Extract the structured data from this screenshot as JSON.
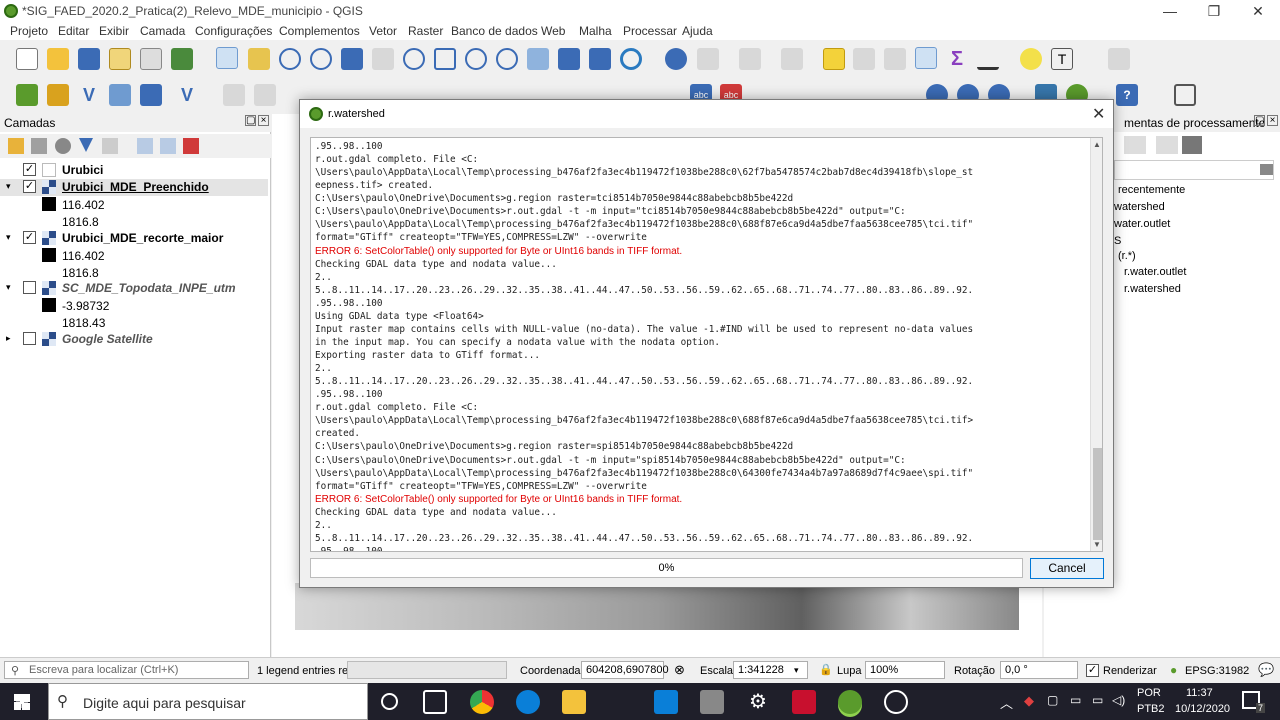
{
  "window": {
    "title": "*SIG_FAED_2020.2_Pratica(2)_Relevo_MDE_municipio - QGIS"
  },
  "menus": [
    "Projeto",
    "Editar",
    "Exibir",
    "Camada",
    "Configurações",
    "Complementos",
    "Vetor",
    "Raster",
    "Banco de dados",
    "Web",
    "Malha",
    "Processar",
    "Ajuda"
  ],
  "layers_panel": {
    "title": "Camadas",
    "layers": [
      {
        "name": "Urubici",
        "checked": true,
        "bold": true,
        "italic": false
      },
      {
        "name": "Urubici_MDE_Preenchido",
        "checked": true,
        "bold": true,
        "underline": true,
        "min": "116.402",
        "max": "1816.8"
      },
      {
        "name": "Urubici_MDE_recorte_maior",
        "checked": true,
        "bold": true,
        "min": "116.402",
        "max": "1816.8"
      },
      {
        "name": "SC_MDE_Topodata_INPE_utm",
        "checked": false,
        "italic": true,
        "min": "-3.98732",
        "max": "1818.43"
      },
      {
        "name": "Google Satellite",
        "checked": false,
        "italic": true
      }
    ]
  },
  "processing_panel": {
    "title": "mentas de processamento",
    "items": [
      "recentemente",
      "watershed",
      "water.outlet",
      "S",
      "(r.*)",
      "r.water.outlet",
      "r.watershed"
    ]
  },
  "dialog": {
    "title": "r.watershed",
    "log_lines": [
      {
        "t": ".95..98..100",
        "err": false
      },
      {
        "t": "r.out.gdal completo. File <C:",
        "err": false
      },
      {
        "t": "\\Users\\paulo\\AppData\\Local\\Temp\\processing_b476af2fa3ec4b119472f1038be288c0\\62f7ba5478574c2bab7d8ec4d39418fb\\slope_st",
        "err": false
      },
      {
        "t": "eepness.tif> created.",
        "err": false
      },
      {
        "t": "C:\\Users\\paulo\\OneDrive\\Documents>g.region raster=tci8514b7050e9844c88abebcb8b5be422d",
        "err": false
      },
      {
        "t": "C:\\Users\\paulo\\OneDrive\\Documents>r.out.gdal -t -m input=\"tci8514b7050e9844c88abebcb8b5be422d\" output=\"C:",
        "err": false
      },
      {
        "t": "\\Users\\paulo\\AppData\\Local\\Temp\\processing_b476af2fa3ec4b119472f1038be288c0\\688f87e6ca9d4a5dbe7faa5638cee785\\tci.tif\"",
        "err": false
      },
      {
        "t": "format=\"GTiff\" createopt=\"TFW=YES,COMPRESS=LZW\" --overwrite",
        "err": false
      },
      {
        "t": "ERROR 6: SetColorTable() only supported for Byte or UInt16 bands in TIFF format.",
        "err": true
      },
      {
        "t": "Checking GDAL data type and nodata value...",
        "err": false
      },
      {
        "t": "2..",
        "err": false
      },
      {
        "t": "5..8..11..14..17..20..23..26..29..32..35..38..41..44..47..50..53..56..59..62..65..68..71..74..77..80..83..86..89..92.",
        "err": false
      },
      {
        "t": ".95..98..100",
        "err": false
      },
      {
        "t": "Using GDAL data type <Float64>",
        "err": false
      },
      {
        "t": "Input raster map contains cells with NULL-value (no-data). The value -1.#IND will be used to represent no-data values",
        "err": false
      },
      {
        "t": "in the input map. You can specify a nodata value with the nodata option.",
        "err": false
      },
      {
        "t": "Exporting raster data to GTiff format...",
        "err": false
      },
      {
        "t": "2..",
        "err": false
      },
      {
        "t": "5..8..11..14..17..20..23..26..29..32..35..38..41..44..47..50..53..56..59..62..65..68..71..74..77..80..83..86..89..92.",
        "err": false
      },
      {
        "t": ".95..98..100",
        "err": false
      },
      {
        "t": "r.out.gdal completo. File <C:",
        "err": false
      },
      {
        "t": "\\Users\\paulo\\AppData\\Local\\Temp\\processing_b476af2fa3ec4b119472f1038be288c0\\688f87e6ca9d4a5dbe7faa5638cee785\\tci.tif>",
        "err": false
      },
      {
        "t": "created.",
        "err": false
      },
      {
        "t": "C:\\Users\\paulo\\OneDrive\\Documents>g.region raster=spi8514b7050e9844c88abebcb8b5be422d",
        "err": false
      },
      {
        "t": "C:\\Users\\paulo\\OneDrive\\Documents>r.out.gdal -t -m input=\"spi8514b7050e9844c88abebcb8b5be422d\" output=\"C:",
        "err": false
      },
      {
        "t": "\\Users\\paulo\\AppData\\Local\\Temp\\processing_b476af2fa3ec4b119472f1038be288c0\\64300fe7434a4b7a97a8689d7f4c9aee\\spi.tif\"",
        "err": false
      },
      {
        "t": "format=\"GTiff\" createopt=\"TFW=YES,COMPRESS=LZW\" --overwrite",
        "err": false
      },
      {
        "t": "ERROR 6: SetColorTable() only supported for Byte or UInt16 bands in TIFF format.",
        "err": true
      },
      {
        "t": "Checking GDAL data type and nodata value...",
        "err": false
      },
      {
        "t": "2..",
        "err": false
      },
      {
        "t": "5..8..11..14..17..20..23..26..29..32..35..38..41..44..47..50..53..56..59..62..65..68..71..74..77..80..83..86..89..92.",
        "err": false
      },
      {
        "t": ".95..98..100",
        "err": false
      }
    ],
    "progress_label": "0%",
    "progress_value": 0,
    "cancel_label": "Cancel"
  },
  "statusbar": {
    "locate_placeholder": "Escreva para localizar (Ctrl+K)",
    "legend_text": "1 legend entries re",
    "coord_label": "Coordenada",
    "coord_value": "604208,6907800",
    "scale_label": "Escala",
    "scale_value": "1:341228",
    "lupa_label": "Lupa",
    "lupa_value": "100%",
    "rotation_label": "Rotação",
    "rotation_value": "0,0 °",
    "render_label": "Renderizar",
    "epsg": "EPSG:31982"
  },
  "taskbar": {
    "search_placeholder": "Digite aqui para pesquisar",
    "lang_top": "POR",
    "lang_bottom": "PTB2",
    "time": "11:37",
    "date": "10/12/2020",
    "notif_count": "7"
  },
  "colors": {
    "accent": "#0078d7",
    "error": "#e00000",
    "qgis_green": "#5a9b2c",
    "taskbar": "#1f1f2a"
  }
}
